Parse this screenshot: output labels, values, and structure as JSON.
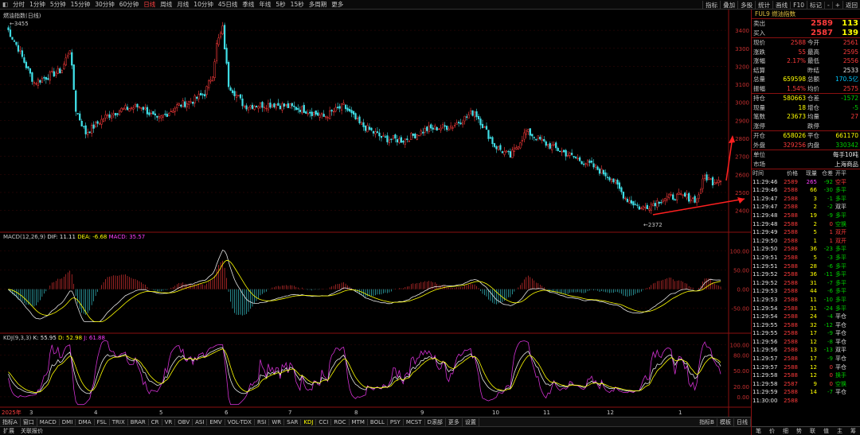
{
  "toolbar": {
    "periods": [
      "分时",
      "1分钟",
      "5分钟",
      "15分钟",
      "30分钟",
      "60分钟",
      "日线",
      "周线",
      "月线",
      "10分钟",
      "45日线",
      "季线",
      "年线",
      "5秒",
      "15秒",
      "多周期",
      "更多"
    ],
    "active_period": "日线",
    "right_items": [
      "指标",
      "叠加",
      "多股",
      "统计",
      "画线",
      "F10",
      "标记",
      "-",
      "+",
      "返回"
    ]
  },
  "chart_main": {
    "title": "燃油指数(日线)",
    "high_label": "3455",
    "low_label": "2372",
    "y_ticks": [
      "3400",
      "3300",
      "3200",
      "3100",
      "3000",
      "2900",
      "2800",
      "2700",
      "2600",
      "2500",
      "2400"
    ]
  },
  "chart_macd": {
    "name": "MACD(12,26,9)",
    "dif": "DIF: 11.11",
    "dea": "DEA: -6.68",
    "macd": "MACD: 35.57",
    "y_ticks": [
      "100.00",
      "50.00",
      "0.00",
      "-50.00"
    ]
  },
  "chart_kdj": {
    "name": "KDJ(9,3,3)",
    "k": "K: 55.95",
    "d": "D: 52.98",
    "j": "J: 61.88",
    "y_ticks": [
      "100.00",
      "80.00",
      "50.00",
      "20.00",
      "0.00"
    ]
  },
  "x_axis": [
    "2025年",
    "3",
    "4",
    "5",
    "6",
    "7",
    "8",
    "9",
    "10",
    "11",
    "12",
    "1"
  ],
  "panel": {
    "title": "FUL9 燃油指数",
    "sell_label": "卖出",
    "sell_price": "2589",
    "sell_vol": "113",
    "buy_label": "买入",
    "buy_price": "2587",
    "buy_vol": "139",
    "quotes": [
      [
        "现价",
        "2588",
        "今开",
        "2561"
      ],
      [
        "涨跌",
        "55",
        "最高",
        "2595"
      ],
      [
        "涨幅",
        "2.17%",
        "最低",
        "2556"
      ],
      [
        "结算",
        "",
        "昨结",
        "2533"
      ],
      [
        "总量",
        "659598",
        "总额",
        "170.5亿"
      ],
      [
        "振幅",
        "1.54%",
        "均价",
        "2575"
      ]
    ],
    "pos": [
      [
        "持仓",
        "580663",
        "仓差",
        "-1572"
      ],
      [
        "现量",
        "18",
        "增仓",
        "-5"
      ],
      [
        "笔数",
        "23673",
        "均量",
        "27"
      ],
      [
        "涨停",
        "",
        "跌停",
        ""
      ]
    ],
    "open_close": [
      [
        "开仓",
        "658026",
        "平仓",
        "661170"
      ],
      [
        "外盘",
        "329256",
        "内盘",
        "330342"
      ]
    ],
    "unit_label": "单位",
    "unit_value": "每手10吨",
    "market_label": "市场",
    "market_value": "上海商品",
    "tick_headers": [
      "时间",
      "价格",
      "现量",
      "仓差",
      "开平"
    ],
    "ticks": [
      [
        "11:29:46",
        "2589",
        "265",
        "-92",
        "空平"
      ],
      [
        "11:29:46",
        "2588",
        "66",
        "-30",
        "多平"
      ],
      [
        "11:29:47",
        "2588",
        "3",
        "-1",
        "多平"
      ],
      [
        "11:29:47",
        "2588",
        "2",
        "-2",
        "双平"
      ],
      [
        "11:29:48",
        "2588",
        "19",
        "-9",
        "多平"
      ],
      [
        "11:29:48",
        "2588",
        "2",
        "0",
        "空换"
      ],
      [
        "11:29:49",
        "2588",
        "5",
        "1",
        "双开"
      ],
      [
        "11:29:50",
        "2588",
        "1",
        "1",
        "双开"
      ],
      [
        "11:29:50",
        "2588",
        "36",
        "-23",
        "多平"
      ],
      [
        "11:29:51",
        "2588",
        "5",
        "-3",
        "多平"
      ],
      [
        "11:29:51",
        "2588",
        "28",
        "-6",
        "多平"
      ],
      [
        "11:29:52",
        "2588",
        "36",
        "-11",
        "多平"
      ],
      [
        "11:29:52",
        "2588",
        "31",
        "-7",
        "多平"
      ],
      [
        "11:29:53",
        "2588",
        "44",
        "-6",
        "多平"
      ],
      [
        "11:29:53",
        "2588",
        "11",
        "-10",
        "多平"
      ],
      [
        "11:29:54",
        "2588",
        "31",
        "-24",
        "多平"
      ],
      [
        "11:29:54",
        "2588",
        "24",
        "-4",
        "平仓"
      ],
      [
        "11:29:55",
        "2588",
        "32",
        "-12",
        "平仓"
      ],
      [
        "11:29:55",
        "2588",
        "17",
        "-9",
        "平仓"
      ],
      [
        "11:29:56",
        "2588",
        "12",
        "-8",
        "平仓"
      ],
      [
        "11:29:56",
        "2588",
        "13",
        "-13",
        "双平"
      ],
      [
        "11:29:57",
        "2588",
        "17",
        "-9",
        "平仓"
      ],
      [
        "11:29:57",
        "2588",
        "12",
        "0",
        "平仓"
      ],
      [
        "11:29:58",
        "2588",
        "12",
        "0",
        "换手"
      ],
      [
        "11:29:58",
        "2587",
        "9",
        "0",
        "空换"
      ],
      [
        "11:29:59",
        "2588",
        "14",
        "-7",
        "平仓"
      ],
      [
        "11:30:00",
        "2588",
        "",
        "",
        ""
      ]
    ],
    "bottom_tabs": [
      "笔",
      "价",
      "细",
      "势",
      "联",
      "值",
      "主",
      "筹"
    ]
  },
  "indicator_tabs": [
    "指标A",
    "窗口",
    "MACD",
    "DMI",
    "DMA",
    "FSL",
    "TRIX",
    "BRAR",
    "CR",
    "VR",
    "OBV",
    "ASI",
    "EMV",
    "VOL-TDX",
    "RSI",
    "WR",
    "SAR",
    "KDJ",
    "CCI",
    "ROC",
    "MTM",
    "BOLL",
    "PSY",
    "MCST",
    "D滚部",
    "更多",
    "设置"
  ],
  "active_indicator": "KDJ",
  "indicator_right": [
    "指标B",
    "模板",
    "日线"
  ],
  "status": {
    "left": "扩展",
    "center": "关联报价"
  }
}
